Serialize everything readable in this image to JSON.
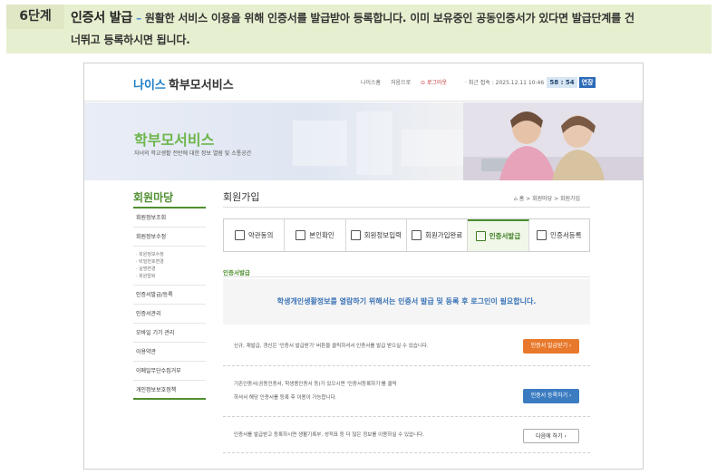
{
  "step": {
    "number": "6단계",
    "title": "인증서 발급",
    "dash": "–",
    "line1": "원활한 서비스 이용을 위해 인증서를 발급받아 등록합니다. 이미 보유중인 공동인증서가 있다면 발급단계를 건",
    "line2": "너뛰고 등록하시면 됩니다."
  },
  "topbar": {
    "logo_prefix": "나이스",
    "logo_name": "학부모서비스",
    "links": [
      "나이스홈",
      "처음으로",
      "로그아웃"
    ],
    "last_access": "· 최근 접속 : 2025.12.11 10:46",
    "timer": "58 : 54",
    "extend": "연장"
  },
  "banner": {
    "title": "학부모서비스",
    "subtitle": "자녀의 학교생활 전반에 대한 정보 열람 및 소통공간"
  },
  "lnb": {
    "title": "회원마당",
    "items": [
      "회원정보조회",
      "회원정보수정"
    ],
    "subitems": [
      "· 회원정보수정",
      "· 비밀번호변경",
      "· 실명변경",
      "· 회원탈퇴"
    ],
    "items2": [
      "인증서발급/등록",
      "인증서관리",
      "모바일 기기 관리",
      "이용약관",
      "이메일무단수집거부",
      "개인정보보호정책"
    ]
  },
  "content": {
    "title": "회원가입",
    "breadcrumb": "⌂ 홈 > 회원마당 > 회원가입",
    "tabs": [
      "약관동의",
      "본인확인",
      "회원정보입력",
      "회원가입완료",
      "인증서발급",
      "인증서등록"
    ],
    "active_tab": 4,
    "section_title": "인증서발급",
    "notice": "학생개인생활정보를 열람하기 위해서는 인증서 발급 및 등록 후 로그인이 필요합니다.",
    "rows": [
      {
        "text1": "신규, 재발급, 갱신은 '인증서 발급받기' 버튼을 클릭하셔서 인증서를 발급 받으실 수 있습니다.",
        "text2": "",
        "button": "인증서 발급받기  ›"
      },
      {
        "text1": "기존인증서(공동인증서, 학생용인증서 등)가 있으시면 '인증서등록하기'를 클릭",
        "text2": "하셔서 해당 인증서를 등록 후 이용이 가능합니다.",
        "button": "인증서 등록하기  ›"
      },
      {
        "text1": "인증서를 발급받고 등록하시면 생활기록부, 성적표 등 더 많은 정보를 이용하실 수 있습니다.",
        "text2": "",
        "button": "다음에 하기   ›"
      }
    ]
  },
  "colors": {
    "accent_green": "#4f8f2f",
    "orange_button": "#e8792c",
    "blue_button": "#3b7cc1"
  }
}
